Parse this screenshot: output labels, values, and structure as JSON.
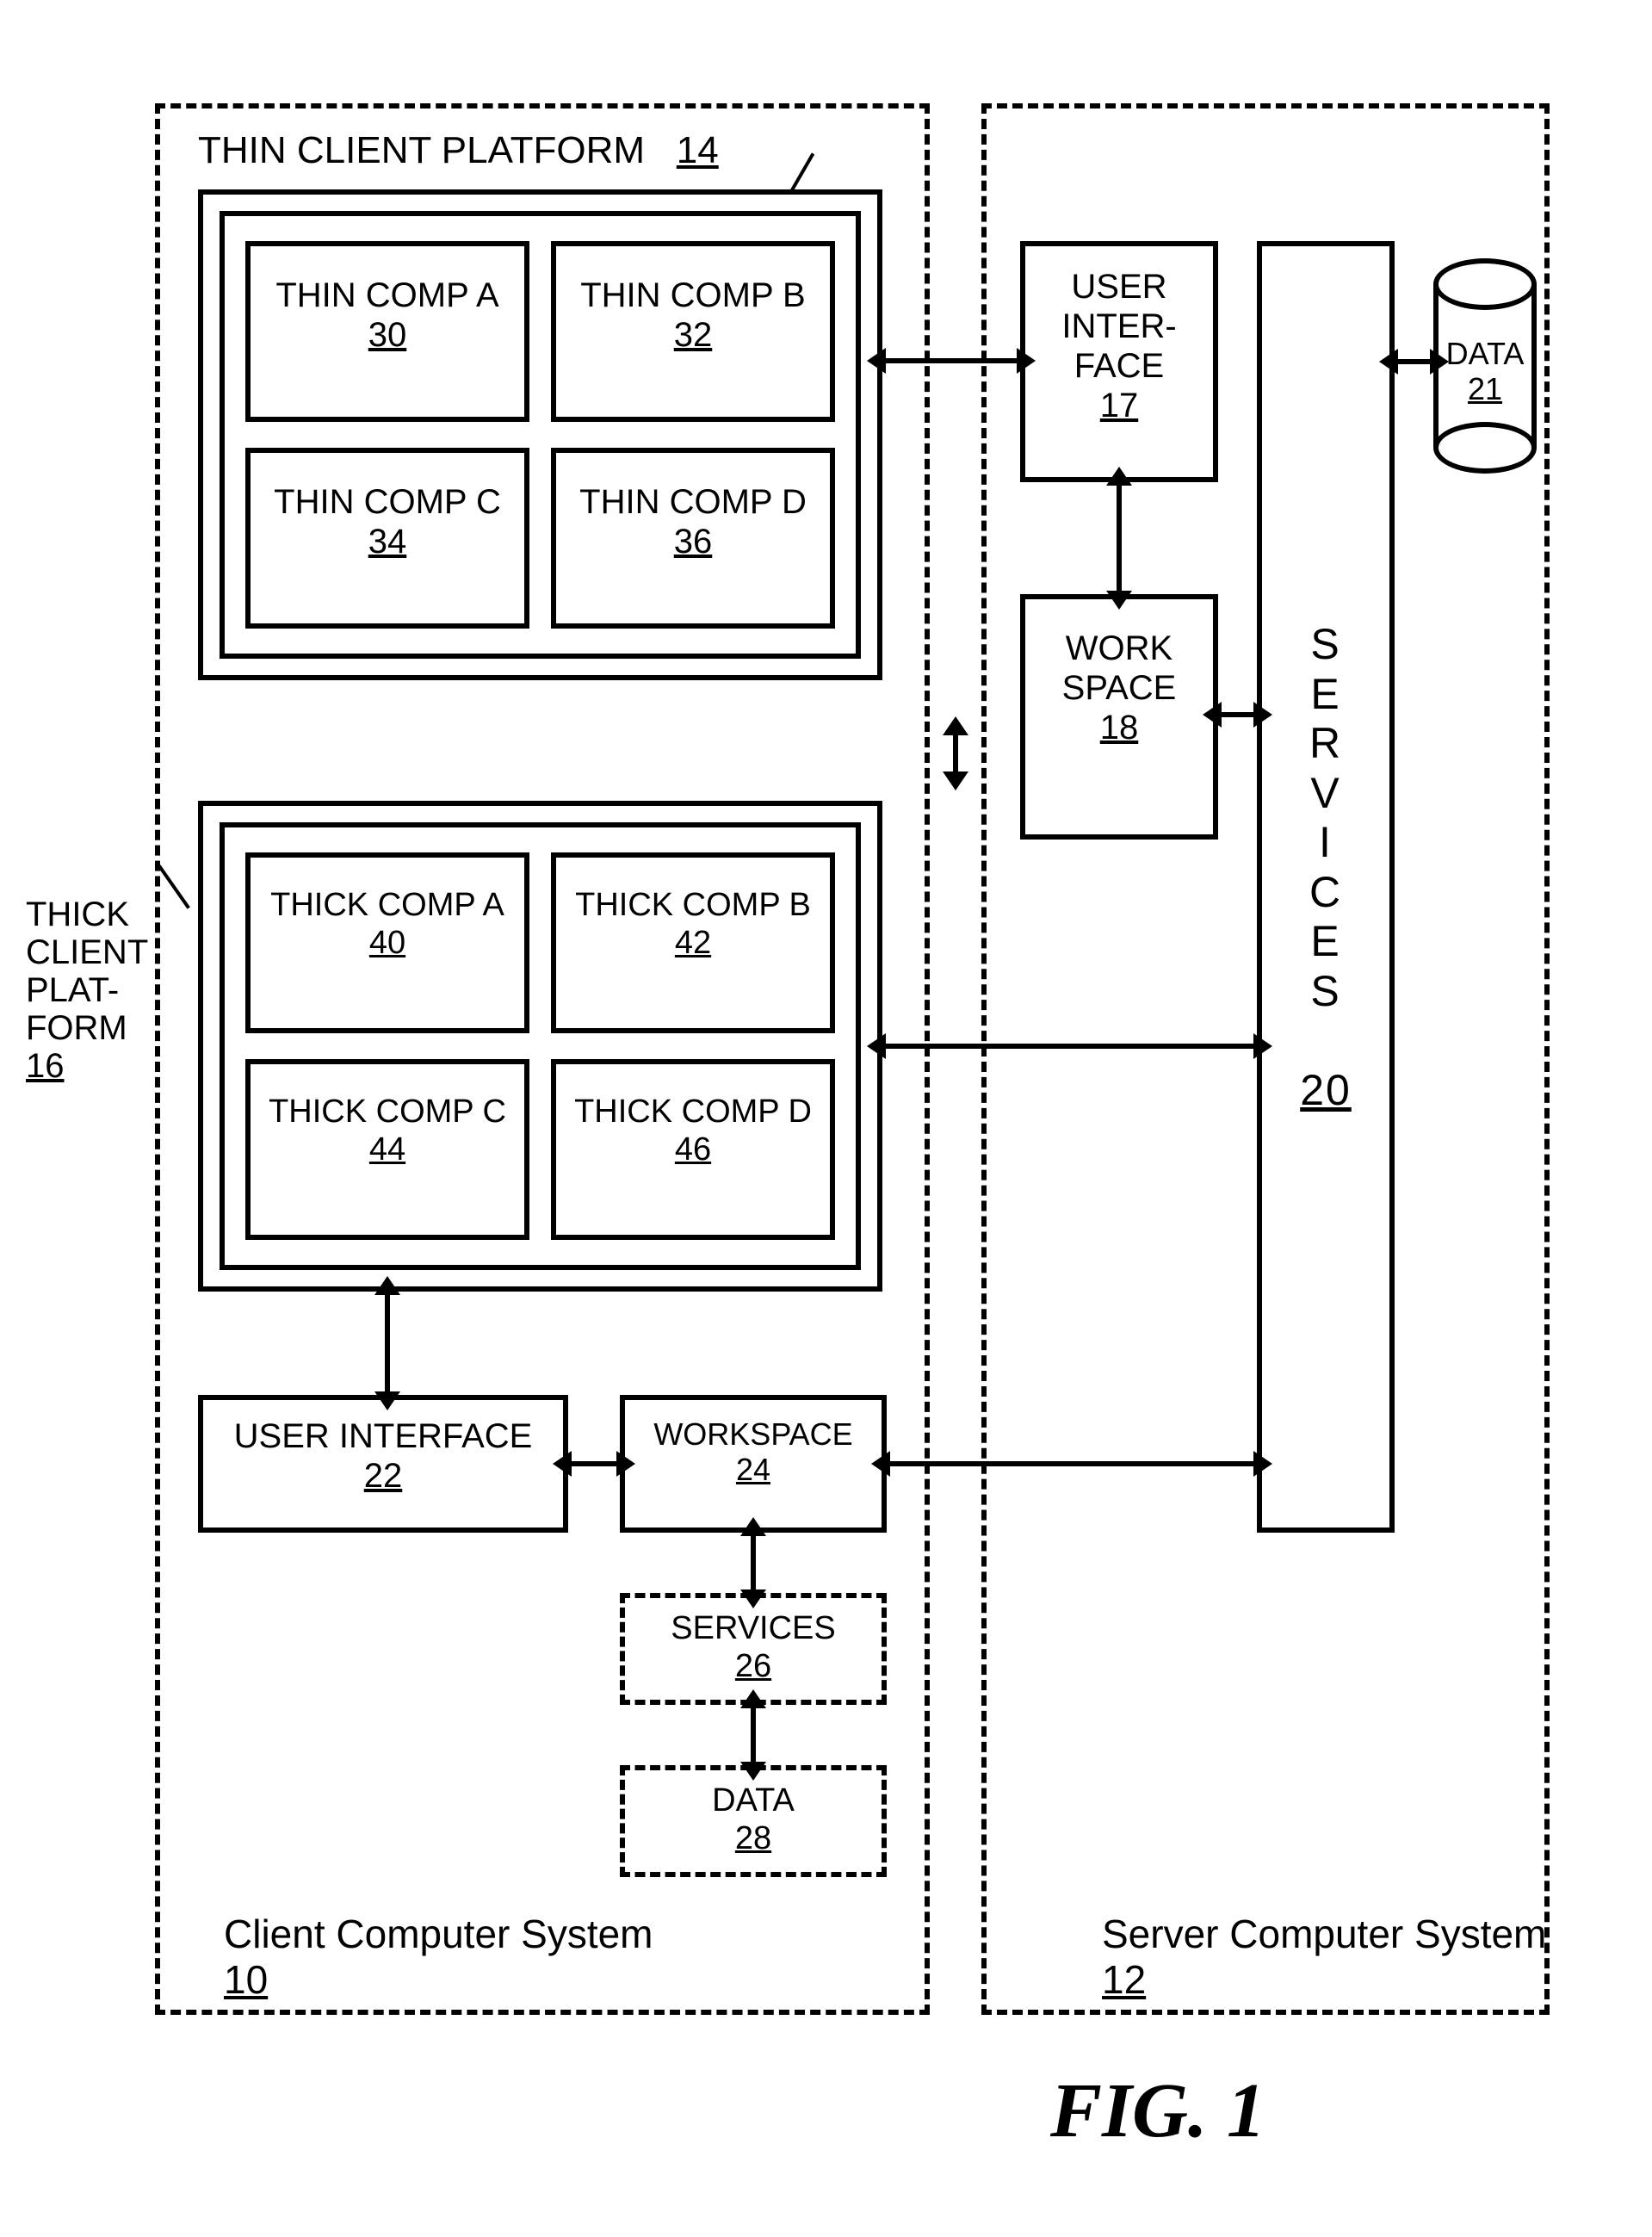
{
  "figure_caption": "FIG. 1",
  "client_system_label": "Client Computer System",
  "client_system_ref": "10",
  "server_system_label": "Server Computer System",
  "server_system_ref": "12",
  "thin_platform_label": "THIN CLIENT PLATFORM",
  "thin_platform_ref": "14",
  "thick_platform_label": "THICK CLIENT PLAT-FORM",
  "thick_platform_ref": "16",
  "thin_comp_a": {
    "label": "THIN COMP A",
    "ref": "30"
  },
  "thin_comp_b": {
    "label": "THIN COMP B",
    "ref": "32"
  },
  "thin_comp_c": {
    "label": "THIN COMP C",
    "ref": "34"
  },
  "thin_comp_d": {
    "label": "THIN COMP D",
    "ref": "36"
  },
  "thick_comp_a": {
    "label": "THICK COMP A",
    "ref": "40"
  },
  "thick_comp_b": {
    "label": "THICK COMP B",
    "ref": "42"
  },
  "thick_comp_c": {
    "label": "THICK COMP C",
    "ref": "44"
  },
  "thick_comp_d": {
    "label": "THICK COMP D",
    "ref": "46"
  },
  "client_ui": {
    "label": "USER INTERFACE",
    "ref": "22"
  },
  "client_workspace": {
    "label": "WORKSPACE",
    "ref": "24"
  },
  "client_services": {
    "label": "SERVICES",
    "ref": "26"
  },
  "client_data": {
    "label": "DATA",
    "ref": "28"
  },
  "server_ui": {
    "label": "USER INTER-FACE",
    "ref": "17"
  },
  "server_workspace": {
    "label": "WORK SPACE",
    "ref": "18"
  },
  "server_services": {
    "label": "SERVICES",
    "ref": "20"
  },
  "server_data": {
    "label": "DATA",
    "ref": "21"
  }
}
